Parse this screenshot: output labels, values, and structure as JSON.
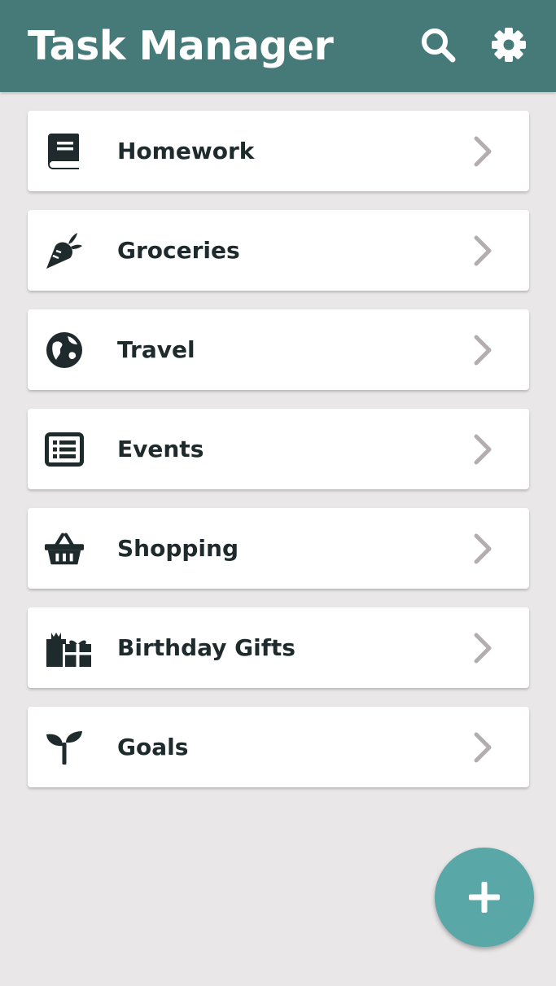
{
  "app": {
    "title": "Task Manager"
  },
  "header": {
    "search_icon": "search-icon",
    "settings_icon": "gear-icon"
  },
  "lists": [
    {
      "label": "Homework",
      "icon": "book-icon"
    },
    {
      "label": "Groceries",
      "icon": "carrot-icon"
    },
    {
      "label": "Travel",
      "icon": "globe-icon"
    },
    {
      "label": "Events",
      "icon": "list-icon"
    },
    {
      "label": "Shopping",
      "icon": "basket-icon"
    },
    {
      "label": "Birthday Gifts",
      "icon": "gifts-icon"
    },
    {
      "label": "Goals",
      "icon": "seedling-icon"
    }
  ],
  "fab": {
    "icon": "plus-icon"
  },
  "colors": {
    "appbar": "#467a79",
    "background": "#e9e7e8",
    "fab": "#59a8a7",
    "icon": "#1e2a2c",
    "chevron": "#b3adaf"
  }
}
